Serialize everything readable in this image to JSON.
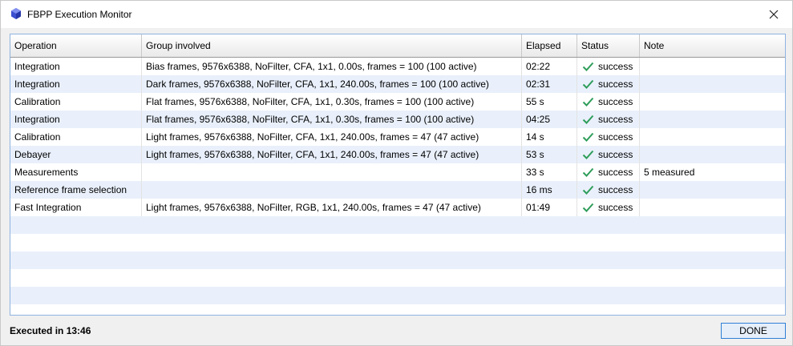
{
  "window": {
    "title": "FBPP Execution Monitor"
  },
  "table": {
    "columns": [
      "Operation",
      "Group involved",
      "Elapsed",
      "Status",
      "Note"
    ],
    "rows": [
      {
        "operation": "Integration",
        "group": "Bias frames, 9576x6388, NoFilter, CFA, 1x1, 0.00s, frames = 100 (100 active)",
        "elapsed": "02:22",
        "status": "success",
        "note": ""
      },
      {
        "operation": "Integration",
        "group": "Dark frames, 9576x6388, NoFilter, CFA, 1x1, 240.00s, frames = 100 (100 active)",
        "elapsed": "02:31",
        "status": "success",
        "note": ""
      },
      {
        "operation": "Calibration",
        "group": "Flat frames, 9576x6388, NoFilter, CFA, 1x1, 0.30s, frames = 100 (100 active)",
        "elapsed": "55 s",
        "status": "success",
        "note": ""
      },
      {
        "operation": "Integration",
        "group": "Flat frames, 9576x6388, NoFilter, CFA, 1x1, 0.30s, frames = 100 (100 active)",
        "elapsed": "04:25",
        "status": "success",
        "note": ""
      },
      {
        "operation": "Calibration",
        "group": "Light frames, 9576x6388, NoFilter, CFA, 1x1, 240.00s, frames = 47 (47 active)",
        "elapsed": "14 s",
        "status": "success",
        "note": ""
      },
      {
        "operation": "Debayer",
        "group": "Light frames, 9576x6388, NoFilter, CFA, 1x1, 240.00s, frames = 47 (47 active)",
        "elapsed": "53 s",
        "status": "success",
        "note": ""
      },
      {
        "operation": "Measurements",
        "group": "",
        "elapsed": "33 s",
        "status": "success",
        "note": "5 measured"
      },
      {
        "operation": "Reference frame selection",
        "group": "",
        "elapsed": "16 ms",
        "status": "success",
        "note": ""
      },
      {
        "operation": "Fast Integration",
        "group": "Light frames, 9576x6388, NoFilter, RGB, 1x1, 240.00s, frames = 47 (47 active)",
        "elapsed": "01:49",
        "status": "success",
        "note": ""
      }
    ]
  },
  "footer": {
    "executed_label": "Executed in 13:46",
    "done_label": "DONE"
  },
  "colors": {
    "success_check": "#2e9d5a",
    "accent": "#2f7fd6",
    "row_alt": "#e9f0fb"
  },
  "icons": {
    "app": "fbpp-app-icon",
    "close": "close-icon",
    "status": "check-icon"
  }
}
